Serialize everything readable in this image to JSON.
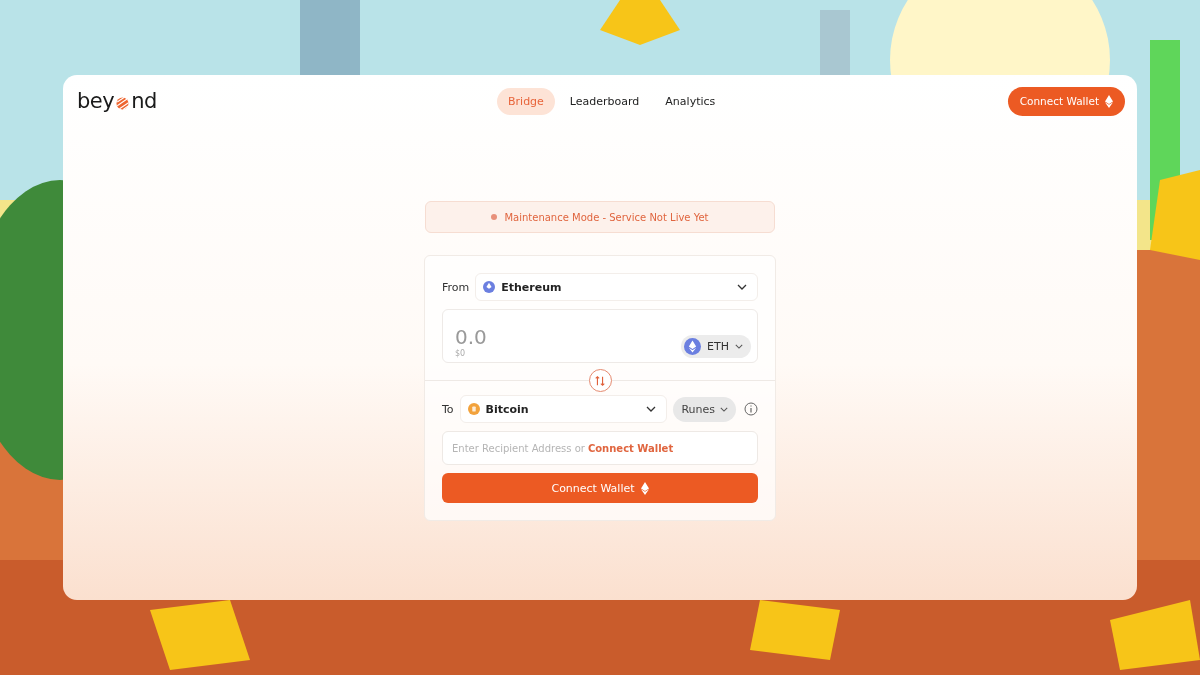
{
  "header": {
    "logo": {
      "before": "bey",
      "after": "nd"
    },
    "nav": [
      {
        "label": "Bridge",
        "selected": true
      },
      {
        "label": "Leaderboard",
        "selected": false
      },
      {
        "label": "Analytics",
        "selected": false
      }
    ],
    "connect_button": "Connect Wallet"
  },
  "notice": "Maintenance Mode - Service Not Live Yet",
  "bridge": {
    "from": {
      "label": "From",
      "chain": "Ethereum"
    },
    "amount": {
      "placeholder": "0.0",
      "usd": "$0",
      "token": "ETH"
    },
    "to": {
      "label": "To",
      "chain": "Bitcoin",
      "protocol": "Runes"
    },
    "recipient": {
      "placeholder": "Enter Recipient Address or",
      "link": "Connect Wallet"
    },
    "submit": "Connect Wallet"
  }
}
